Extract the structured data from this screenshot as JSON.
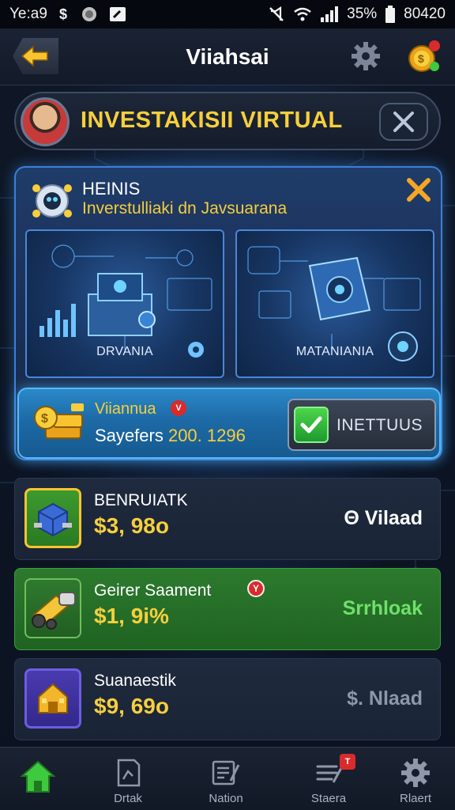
{
  "status_bar": {
    "time": "Ye:a9",
    "battery": "35%",
    "clock_right": "80420"
  },
  "header": {
    "title": "Viiahsai"
  },
  "banner": {
    "title": "INVESTAKISII VIRTUAL"
  },
  "panel": {
    "title": "HEINIS",
    "subtitle": "Inverstulliaki dn Javsuarana",
    "cards": [
      {
        "label": "DRVANIA"
      },
      {
        "label": "MATANIANIA"
      }
    ],
    "reward": {
      "title": "Viiannua",
      "badge": "V",
      "text_prefix": "Sayefers",
      "text_value": "200. 1296"
    },
    "invest_button": {
      "label": "INETTUUS"
    }
  },
  "list": [
    {
      "name": "BENRUIATK",
      "price": "$3, 98o",
      "action": "Θ Vilaad"
    },
    {
      "name": "Geirer Saament",
      "price": "$1, 9i%",
      "action": "Srrhloak",
      "badge": "Y"
    },
    {
      "name": "Suanaestik",
      "price": "$9, 69o",
      "action": "$. Nlaad"
    }
  ],
  "nav": [
    {
      "label": ""
    },
    {
      "label": "Drtak"
    },
    {
      "label": "Nation"
    },
    {
      "label": "Staera",
      "badge": "T"
    },
    {
      "label": "Rlaert"
    }
  ],
  "colors": {
    "accent_gold": "#f7cf3c",
    "active_green": "#2c7a2e",
    "panel_blue": "#1f3c6a",
    "nav_home_green": "#3ec93e"
  },
  "icons": {
    "back": "arrow-left-icon",
    "settings": "gear-icon",
    "coins": "coins-icon",
    "close": "close-icon",
    "check": "check-icon",
    "home": "home-icon"
  }
}
